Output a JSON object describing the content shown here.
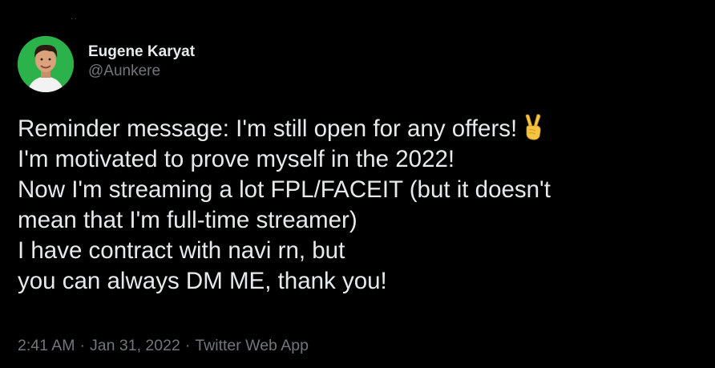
{
  "tweet": {
    "author": {
      "display_name": "Eugene Karyat",
      "handle": "@Aunkere",
      "avatar_icon": "profile-photo"
    },
    "text_lines": [
      "Reminder message: I'm still open for any offers!",
      "I'm motivated to prove myself in the 2022!",
      "Now I'm streaming a lot FPL/FACEIT (but it doesn't",
      "mean that I'm full-time streamer)",
      "I have contract with navi rn, but",
      "you can always DM ME, thank you!"
    ],
    "emoji": "victory-hand-icon",
    "time": "2:41 AM",
    "date": "Jan 31, 2022",
    "source": "Twitter Web App",
    "separator": "·"
  },
  "colors": {
    "background": "#000000",
    "primary_text": "#e7e9ea",
    "secondary_text": "#71767b",
    "avatar_bg": "#2bb24a"
  }
}
